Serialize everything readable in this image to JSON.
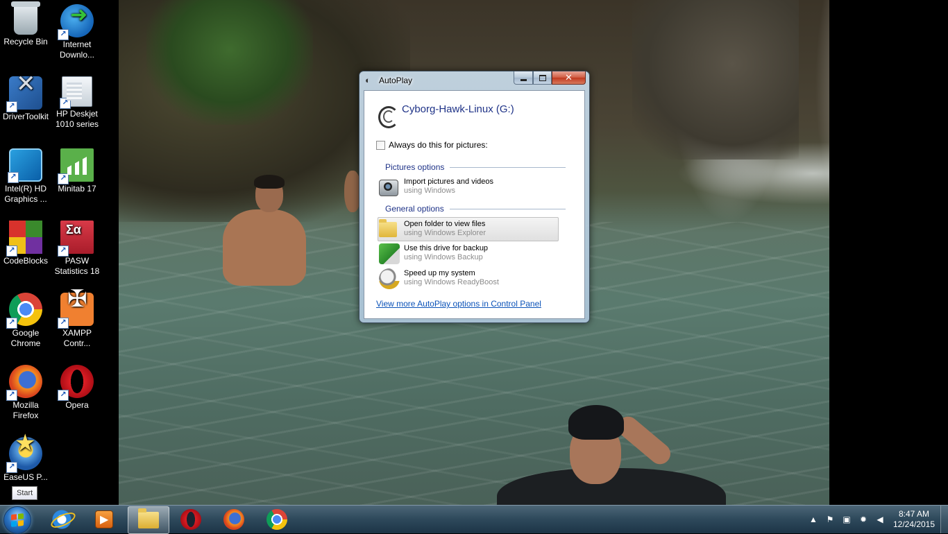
{
  "desktop_icons": [
    {
      "label": "Recycle Bin",
      "icon": "recycle-bin-icon"
    },
    {
      "label": "Internet Downlo...",
      "icon": "internet-download-manager-icon"
    },
    {
      "label": "DriverToolkit",
      "icon": "drivertoolkit-icon"
    },
    {
      "label": "HP Deskjet 1010 series",
      "icon": "hp-printer-icon"
    },
    {
      "label": "Intel(R) HD Graphics ...",
      "icon": "intel-graphics-icon"
    },
    {
      "label": "Minitab 17",
      "icon": "minitab-icon"
    },
    {
      "label": "CodeBlocks",
      "icon": "codeblocks-icon"
    },
    {
      "label": "PASW Statistics 18",
      "icon": "pasw-statistics-icon"
    },
    {
      "label": "Google Chrome",
      "icon": "chrome-icon"
    },
    {
      "label": "XAMPP Contr...",
      "icon": "xampp-icon"
    },
    {
      "label": "Mozilla Firefox",
      "icon": "firefox-icon"
    },
    {
      "label": "Opera",
      "icon": "opera-icon"
    },
    {
      "label": "EaseUS P...",
      "icon": "easeus-icon"
    }
  ],
  "start_tooltip": "Start",
  "autoplay": {
    "window_title": "AutoPlay",
    "drive_name": "Cyborg-Hawk-Linux (G:)",
    "always_checkbox_label": "Always do this for pictures:",
    "always_checked": false,
    "pictures_header": "Pictures options",
    "pictures_options": [
      {
        "title": "Import pictures and videos",
        "subtitle": "using Windows",
        "icon": "camera-icon"
      }
    ],
    "general_header": "General options",
    "general_options": [
      {
        "title": "Open folder to view files",
        "subtitle": "using Windows Explorer",
        "icon": "folder-icon",
        "highlighted": true
      },
      {
        "title": "Use this drive for backup",
        "subtitle": "using Windows Backup",
        "icon": "backup-icon"
      },
      {
        "title": "Speed up my system",
        "subtitle": "using Windows ReadyBoost",
        "icon": "readyboost-icon"
      }
    ],
    "control_panel_link": "View more AutoPlay options in Control Panel"
  },
  "taskbar": {
    "pinned": [
      {
        "name": "internet-explorer",
        "icon": "internet-explorer-icon"
      },
      {
        "name": "media-player",
        "icon": "media-player-icon"
      },
      {
        "name": "windows-explorer",
        "icon": "folder-icon",
        "active": true
      },
      {
        "name": "opera",
        "icon": "opera-icon"
      },
      {
        "name": "firefox",
        "icon": "firefox-icon"
      },
      {
        "name": "chrome",
        "icon": "chrome-icon"
      }
    ],
    "tray_icons": [
      "show-hidden-icons-icon",
      "action-center-flag-icon",
      "safely-remove-hardware-icon",
      "network-icon",
      "volume-icon"
    ],
    "clock_time": "8:47 AM",
    "clock_date": "12/24/2015"
  }
}
